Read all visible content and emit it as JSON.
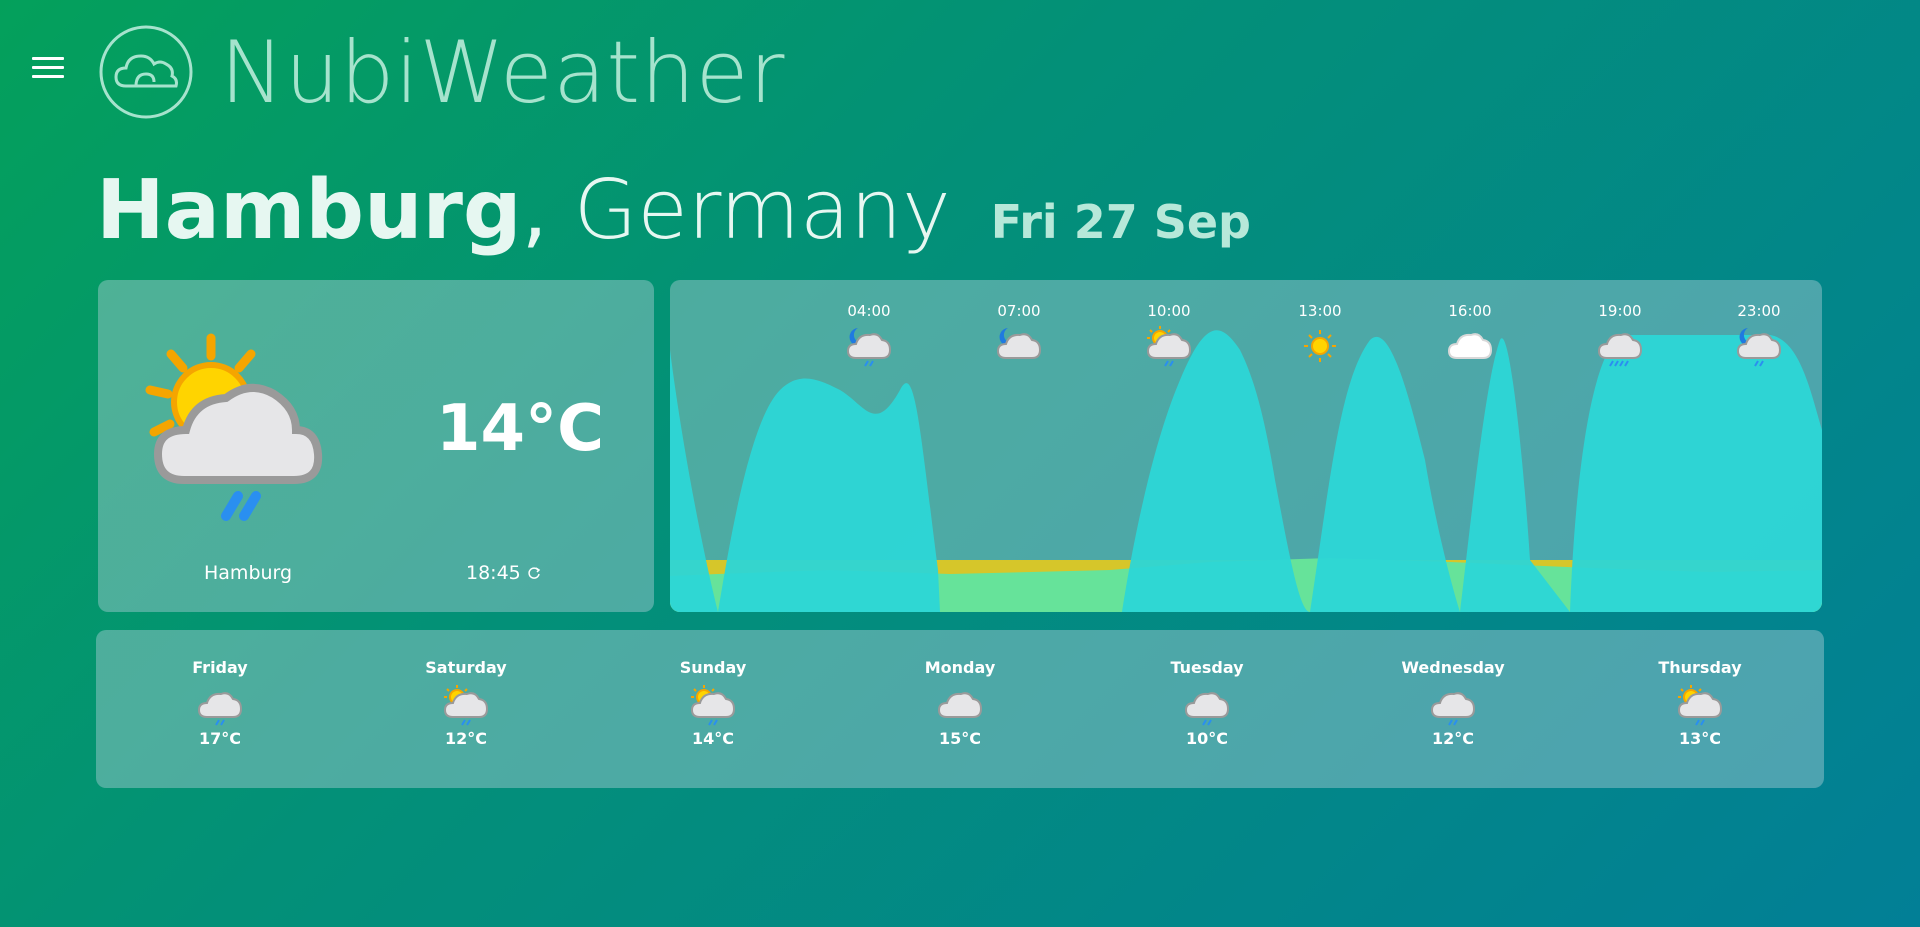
{
  "app": {
    "title": "NubiWeather",
    "menu_icon": "hamburger-menu-icon",
    "logo_icon": "cloud-logo-icon"
  },
  "location": {
    "city": "Hamburg",
    "separator": ",",
    "country": "Germany",
    "date": "Fri 27 Sep"
  },
  "current": {
    "icon": "sun-cloud-rain-icon",
    "temperature": "14°C",
    "city": "Hamburg",
    "updated_time": "18:45",
    "refresh_icon": "refresh-icon"
  },
  "hourly": [
    {
      "time": "04:00",
      "icon": "moon-cloud-rain"
    },
    {
      "time": "07:00",
      "icon": "moon-cloud"
    },
    {
      "time": "10:00",
      "icon": "sun-cloud-rain"
    },
    {
      "time": "13:00",
      "icon": "sun"
    },
    {
      "time": "16:00",
      "icon": "cloud"
    },
    {
      "time": "19:00",
      "icon": "cloud-heavy-rain"
    },
    {
      "time": "23:00",
      "icon": "moon-cloud-rain"
    }
  ],
  "forecast": [
    {
      "day": "Friday",
      "icon": "cloud-rain",
      "temp": "17°C"
    },
    {
      "day": "Saturday",
      "icon": "sun-cloud-rain",
      "temp": "12°C"
    },
    {
      "day": "Sunday",
      "icon": "sun-cloud-rain",
      "temp": "14°C"
    },
    {
      "day": "Monday",
      "icon": "cloud",
      "temp": "15°C"
    },
    {
      "day": "Tuesday",
      "icon": "cloud-rain",
      "temp": "10°C"
    },
    {
      "day": "Wednesday",
      "icon": "cloud-rain",
      "temp": "12°C"
    },
    {
      "day": "Thursday",
      "icon": "sun-cloud-rain",
      "temp": "13°C"
    }
  ],
  "colors": {
    "cloud_area": "#2cd6d6",
    "sun_area": "#d6c62a",
    "ground_band": "#66e39a",
    "title": "#a6e3cd"
  }
}
